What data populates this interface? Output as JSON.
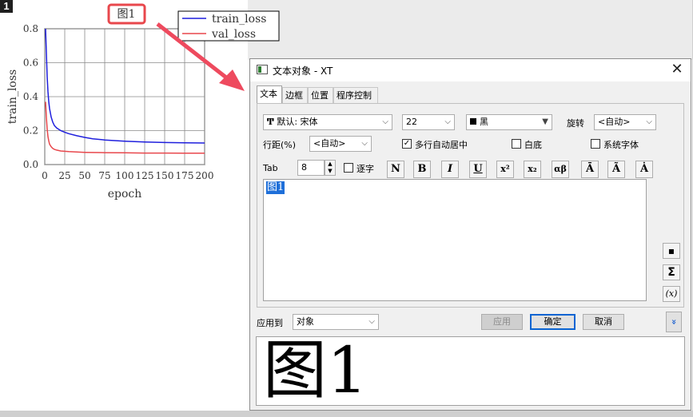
{
  "page_badge": "1",
  "chart": {
    "title": "图1",
    "xlabel": "epoch",
    "ylabel": "train_loss",
    "xticks": [
      "0",
      "25",
      "50",
      "75",
      "100",
      "125",
      "150",
      "175",
      "200"
    ],
    "yticks": [
      "0.0",
      "0.2",
      "0.4",
      "0.6",
      "0.8"
    ],
    "legend": [
      "train_loss",
      "val_loss"
    ],
    "colors": {
      "train": "#1f1fdd",
      "val": "#e8474c",
      "annotation": "#e8474c"
    }
  },
  "chart_data": {
    "type": "line",
    "title": "图1",
    "xlabel": "epoch",
    "ylabel": "train_loss",
    "xlim": [
      0,
      200
    ],
    "ylim": [
      0,
      0.8
    ],
    "grid": true,
    "legend_position": "top-right-outside",
    "x": [
      1,
      2,
      3,
      4,
      5,
      6,
      8,
      10,
      12,
      15,
      20,
      25,
      30,
      40,
      50,
      60,
      75,
      100,
      125,
      150,
      175,
      200
    ],
    "series": [
      {
        "name": "train_loss",
        "color": "#1f1fdd",
        "values": [
          0.8,
          0.66,
          0.52,
          0.43,
          0.37,
          0.33,
          0.28,
          0.25,
          0.23,
          0.215,
          0.2,
          0.19,
          0.182,
          0.17,
          0.16,
          0.152,
          0.145,
          0.138,
          0.133,
          0.13,
          0.128,
          0.127
        ]
      },
      {
        "name": "val_loss",
        "color": "#e8474c",
        "values": [
          0.37,
          0.28,
          0.21,
          0.165,
          0.14,
          0.12,
          0.105,
          0.095,
          0.09,
          0.085,
          0.08,
          0.078,
          0.076,
          0.074,
          0.072,
          0.071,
          0.07,
          0.069,
          0.068,
          0.068,
          0.067,
          0.067
        ]
      }
    ]
  },
  "dialog": {
    "title": "文本对象 - XT",
    "close": "✕",
    "tabs": [
      "文本",
      "边框",
      "位置",
      "程序控制"
    ],
    "font_icon": "Ͳ",
    "font_value": "默认: 宋体",
    "size_value": "22",
    "color_value": "黑",
    "color_swatch": "#000000",
    "rotate_label": "旋转",
    "rotate_value": "<自动>",
    "linespacing_label": "行距(%)",
    "linespacing_value": "<自动>",
    "multiline_label": "多行自动居中",
    "multiline_checked": "✓",
    "whitebg_label": "白底",
    "sysfont_label": "系统字体",
    "tab_label": "Tab",
    "tab_value": "8",
    "perchar_label": "逐字",
    "format_buttons": [
      "N",
      "B",
      "I",
      "U",
      "x²",
      "x₂",
      "αβ",
      "Ā",
      "Ã",
      "Ȧ"
    ],
    "text_content": "图1",
    "side_buttons": [
      "▪",
      "Σ",
      "(x)"
    ],
    "apply_to_label": "应用到",
    "apply_to_value": "对象",
    "apply_btn": "应用",
    "ok_btn": "确定",
    "cancel_btn": "取消",
    "expand_icon": "»",
    "preview_text": "图1"
  }
}
